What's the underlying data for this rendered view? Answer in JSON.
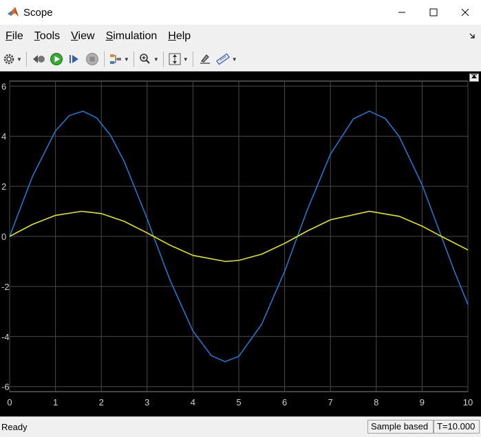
{
  "window": {
    "title": "Scope",
    "controls": {
      "minimize": "—",
      "maximize": "☐",
      "close": "✕"
    }
  },
  "menu": {
    "items": [
      {
        "key": "F",
        "rest": "ile"
      },
      {
        "key": "T",
        "rest": "ools"
      },
      {
        "key": "V",
        "rest": "iew"
      },
      {
        "key": "S",
        "rest": "imulation"
      },
      {
        "key": "H",
        "rest": "elp"
      }
    ],
    "undock_icon": "undock-arrow-icon"
  },
  "toolbar": {
    "icons": [
      "gear-icon",
      "step-back-icon",
      "run-icon",
      "step-forward-icon",
      "stop-icon",
      "signal-selector-icon",
      "zoom-in-icon",
      "autoscale-icon",
      "highlight-icon",
      "measure-icon"
    ]
  },
  "status": {
    "ready": "Ready",
    "mode": "Sample based",
    "time": "T=10.000"
  },
  "colors": {
    "series1": "#1f77d0",
    "series2": "#e6e600",
    "grid": "#4a4a4a",
    "axes_text": "#d0d0d0"
  },
  "chart_data": {
    "type": "line",
    "xlim": [
      0,
      10
    ],
    "ylim": [
      -6.2,
      6.2
    ],
    "xticks": [
      0,
      1,
      2,
      3,
      4,
      5,
      6,
      7,
      8,
      9,
      10
    ],
    "yticks": [
      -6,
      -4,
      -2,
      0,
      2,
      4,
      6
    ],
    "grid": true,
    "series": [
      {
        "color": "#1f77d0",
        "x": [
          0,
          0.5,
          1.0,
          1.3,
          1.6,
          1.9,
          2.2,
          2.5,
          3.0,
          3.14,
          3.5,
          4.0,
          4.4,
          4.7,
          5.0,
          5.5,
          6.0,
          6.28,
          6.5,
          7.0,
          7.5,
          7.85,
          8.2,
          8.5,
          9.0,
          9.42,
          9.7,
          10.0
        ],
        "y": [
          0,
          2.4,
          4.21,
          4.82,
          5.0,
          4.73,
          4.04,
          2.99,
          0.71,
          0.0,
          -1.75,
          -3.78,
          -4.76,
          -5.0,
          -4.79,
          -3.51,
          -1.4,
          0.0,
          1.08,
          3.28,
          4.69,
          5.0,
          4.7,
          3.99,
          2.06,
          0.0,
          -1.37,
          -2.72
        ]
      },
      {
        "color": "#e6e600",
        "x": [
          0,
          0.5,
          1.0,
          1.57,
          2.0,
          2.5,
          3.0,
          3.14,
          3.5,
          4.0,
          4.71,
          5.0,
          5.5,
          6.0,
          6.28,
          6.5,
          7.0,
          7.85,
          8.5,
          9.0,
          9.42,
          10.0
        ],
        "y": [
          0,
          0.48,
          0.84,
          1.0,
          0.91,
          0.6,
          0.14,
          0.0,
          -0.35,
          -0.76,
          -1.0,
          -0.96,
          -0.71,
          -0.28,
          0.0,
          0.22,
          0.66,
          1.0,
          0.8,
          0.41,
          0.0,
          -0.54
        ]
      }
    ]
  }
}
